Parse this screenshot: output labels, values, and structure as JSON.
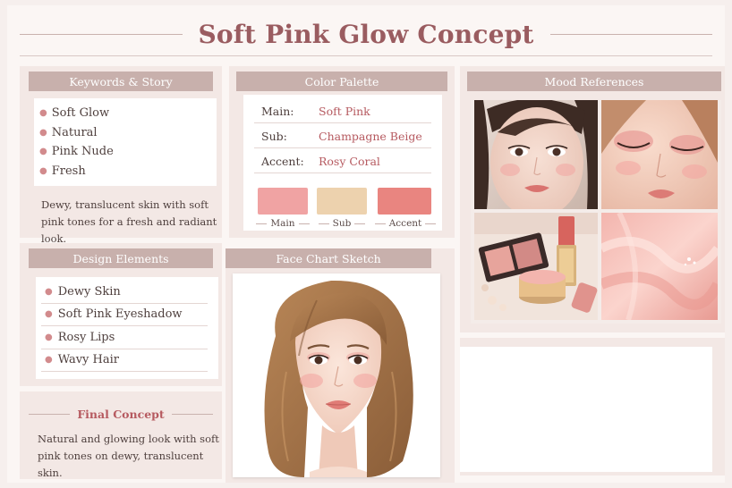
{
  "title": "Soft Pink Glow Concept",
  "keywords": {
    "heading": "Keywords & Story",
    "items": [
      "Soft Glow",
      "Natural",
      "Pink Nude",
      "Fresh"
    ],
    "story_line1": "Dewy, translucent skin with soft",
    "story_line2": "pink tones for a fresh and radiant look."
  },
  "palette": {
    "heading": "Color Palette",
    "rows": [
      {
        "key": "Main:",
        "value": "Soft Pink"
      },
      {
        "key": "Sub:",
        "value": "Champagne Beige"
      },
      {
        "key": "Accent:",
        "value": "Rosy Coral"
      }
    ],
    "swatches": [
      {
        "label": "Main",
        "color": "#f0a3a3"
      },
      {
        "label": "Sub",
        "color": "#edd2ae"
      },
      {
        "label": "Accent",
        "color": "#e98580"
      }
    ]
  },
  "mood": {
    "heading": "Mood References",
    "images": [
      "portrait-closeup",
      "eyeshadow-closeup",
      "makeup-products",
      "pink-satin"
    ]
  },
  "design": {
    "heading": "Design Elements",
    "items": [
      "Dewy Skin",
      "Soft Pink Eyeshadow",
      "Rosy Lips",
      "Wavy Hair"
    ]
  },
  "face_chart": {
    "heading": "Face Chart Sketch"
  },
  "final": {
    "heading": "Final Concept",
    "line1": "Natural and glowing look with soft",
    "line2": "pink tones on dewy, translucent skin."
  },
  "colors": {
    "accent": "#9a5c60",
    "head_bg": "#c8b0ac",
    "panel_bg": "#f3e8e5",
    "bullet": "#d28b8d"
  }
}
